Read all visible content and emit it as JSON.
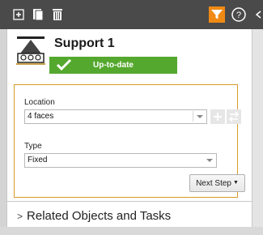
{
  "toolbar": {
    "icons": [
      "add-icon",
      "copy-icon",
      "delete-icon",
      "filter-icon",
      "help-icon",
      "chevron-left-icon"
    ],
    "filter_color": "#f08a14"
  },
  "header": {
    "title": "Support 1",
    "status": "Up-to-date",
    "status_color": "#55a82e"
  },
  "form": {
    "accent_color": "#d99a2b",
    "location_label": "Location",
    "location_value": "4 faces",
    "type_label": "Type",
    "type_value": "Fixed",
    "next_step_label": "Next Step"
  },
  "related": {
    "label": "Related Objects and Tasks"
  }
}
